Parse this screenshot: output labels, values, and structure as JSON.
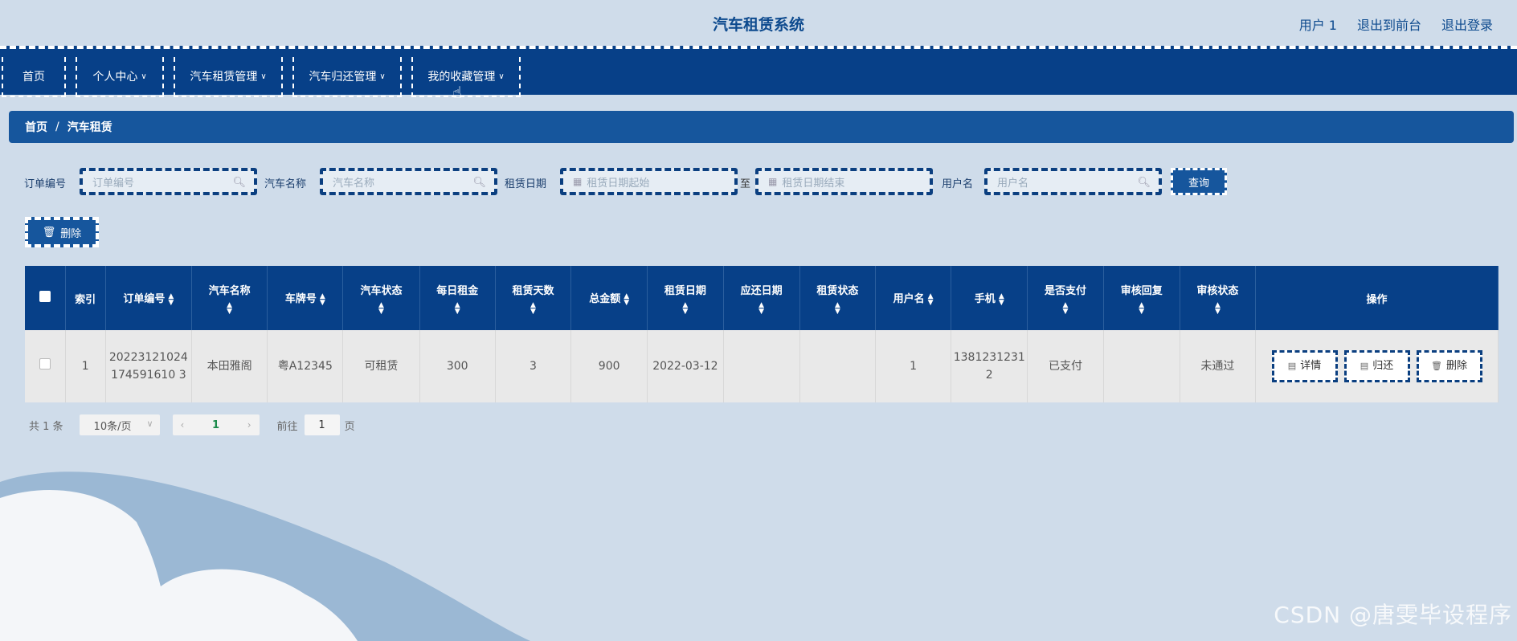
{
  "header": {
    "title": "汽车租赁系统",
    "links": [
      "用户 1",
      "退出到前台",
      "退出登录"
    ]
  },
  "nav": {
    "items": [
      {
        "label": "首页",
        "dropdown": false
      },
      {
        "label": "个人中心",
        "dropdown": true
      },
      {
        "label": "汽车租赁管理",
        "dropdown": true
      },
      {
        "label": "汽车归还管理",
        "dropdown": true
      },
      {
        "label": "我的收藏管理",
        "dropdown": true
      }
    ]
  },
  "breadcrumb": {
    "home": "首页",
    "sep": "/",
    "current": "汽车租赁"
  },
  "search": {
    "order_label": "订单编号",
    "order_placeholder": "订单编号",
    "car_label": "汽车名称",
    "car_placeholder": "汽车名称",
    "date_label": "租赁日期",
    "date_start_placeholder": "租赁日期起始",
    "date_to": "至",
    "date_end_placeholder": "租赁日期结束",
    "user_label": "用户名",
    "user_placeholder": "用户名",
    "query_label": "查询"
  },
  "toolbar": {
    "delete_label": "删除"
  },
  "table": {
    "columns": [
      "索引",
      "订单编号",
      "汽车名称",
      "车牌号",
      "汽车状态",
      "每日租金",
      "租赁天数",
      "总金额",
      "租赁日期",
      "应还日期",
      "租赁状态",
      "用户名",
      "手机",
      "是否支付",
      "审核回复",
      "审核状态",
      "操作"
    ],
    "rows": [
      {
        "index": "1",
        "order_no": "20223121024174591610 3",
        "car_name": "本田雅阁",
        "plate": "粤A12345",
        "car_status": "可租赁",
        "daily_rent": "300",
        "days": "3",
        "total": "900",
        "rent_date": "2022-03-12",
        "due_date": "",
        "rent_status": "",
        "username": "1",
        "phone": "13812312312",
        "paid": "已支付",
        "review_reply": "",
        "review_status": "未通过",
        "actions": [
          "详情",
          "归还",
          "删除"
        ]
      }
    ]
  },
  "pager": {
    "total": "共 1 条",
    "page_size": "10条/页",
    "current": "1",
    "goto_label": "前往",
    "goto_value": "1",
    "page_unit": "页"
  },
  "watermark": "CSDN @唐雯毕设程序"
}
